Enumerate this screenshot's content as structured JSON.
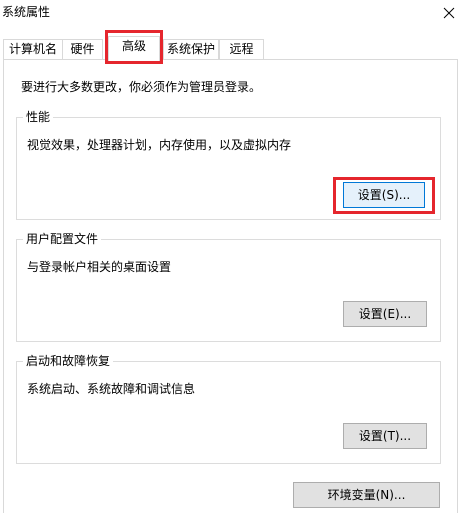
{
  "window": {
    "title": "系统属性"
  },
  "tabs": [
    {
      "label": "计算机名"
    },
    {
      "label": "硬件"
    },
    {
      "label": "高级"
    },
    {
      "label": "系统保护"
    },
    {
      "label": "远程"
    }
  ],
  "active_tab": "高级",
  "admin_note": "要进行大多数更改，你必须作为管理员登录。",
  "performance": {
    "title": "性能",
    "description": "视觉效果，处理器计划，内存使用，以及虚拟内存",
    "button_label": "设置(S)..."
  },
  "user_profiles": {
    "title": "用户配置文件",
    "description": "与登录帐户相关的桌面设置",
    "button_label": "设置(E)..."
  },
  "startup_recovery": {
    "title": "启动和故障恢复",
    "description": "系统启动、系统故障和调试信息",
    "button_label": "设置(T)..."
  },
  "env_button_label": "环境变量(N)...",
  "colors": {
    "highlight_box": "#e5262d",
    "focus_border": "#0078d7"
  },
  "icons": {
    "close": "close-icon"
  }
}
